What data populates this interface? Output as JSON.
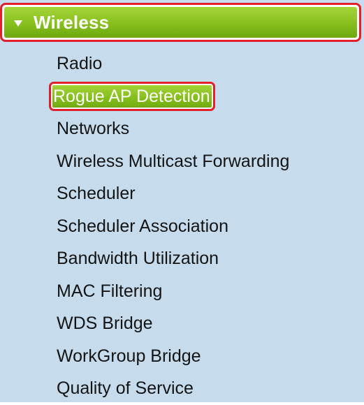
{
  "section": {
    "title": "Wireless",
    "expanded": true,
    "icon": "triangle-down-icon",
    "highlight_color": "#e0202a",
    "header_color": "#86bf1d"
  },
  "menu": {
    "items": [
      {
        "label": "Radio",
        "active": false
      },
      {
        "label": "Rogue AP Detection",
        "active": true
      },
      {
        "label": "Networks",
        "active": false
      },
      {
        "label": "Wireless Multicast Forwarding",
        "active": false
      },
      {
        "label": "Scheduler",
        "active": false
      },
      {
        "label": "Scheduler Association",
        "active": false
      },
      {
        "label": "Bandwidth Utilization",
        "active": false
      },
      {
        "label": "MAC Filtering",
        "active": false
      },
      {
        "label": "WDS Bridge",
        "active": false
      },
      {
        "label": "WorkGroup Bridge",
        "active": false
      },
      {
        "label": "Quality of Service",
        "active": false
      }
    ]
  }
}
